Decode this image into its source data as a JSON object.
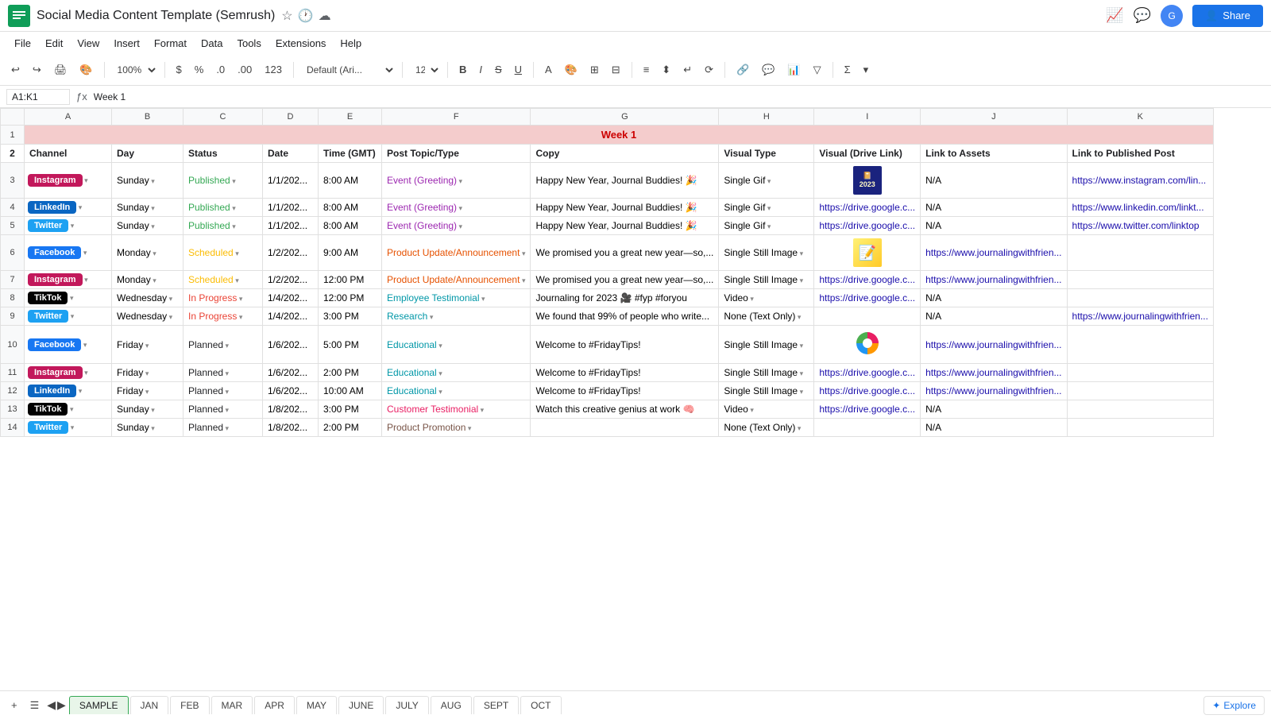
{
  "app": {
    "icon": "📊",
    "title": "Social Media Content Template (Semrush)",
    "menu": [
      "File",
      "Edit",
      "View",
      "Insert",
      "Format",
      "Data",
      "Tools",
      "Extensions",
      "Help"
    ],
    "share_label": "Share",
    "explore_label": "Explore"
  },
  "toolbar": {
    "zoom": "100%",
    "currency": "$",
    "percent": "%",
    "decimal_less": ".0",
    "decimal_more": ".00",
    "format_123": "123",
    "font_family": "Default (Ari...",
    "font_size": "12",
    "bold": "B",
    "italic": "I",
    "strikethrough": "S",
    "underline": "U"
  },
  "formula_bar": {
    "cell_ref": "A1:K1",
    "formula": "Week 1"
  },
  "sheet": {
    "week_label": "Week 1",
    "headers": [
      "Channel",
      "Day",
      "Status",
      "Date",
      "Time (GMT)",
      "Post Topic/Type",
      "Copy",
      "Visual Type",
      "Visual (Drive Link)",
      "Link to Assets",
      "Link to Published Post"
    ],
    "col_letters": [
      "A",
      "B",
      "C",
      "D",
      "E",
      "F",
      "G",
      "H",
      "I",
      "J",
      "K"
    ],
    "rows": [
      {
        "row_num": 3,
        "channel": "Instagram",
        "channel_type": "instagram",
        "day": "Sunday",
        "status": "Published",
        "status_type": "published",
        "date": "1/1/202...",
        "time": "8:00 AM",
        "topic": "Event (Greeting)",
        "topic_type": "event",
        "copy": "Happy New Year, Journal Buddies! 🎉",
        "visual_type": "Single Gif",
        "visual_link": "",
        "link_assets": "N/A",
        "link_published": "https://www.instagram.com/lin...",
        "has_thumb": "2023"
      },
      {
        "row_num": 4,
        "channel": "LinkedIn",
        "channel_type": "linkedin",
        "day": "Sunday",
        "status": "Published",
        "status_type": "published",
        "date": "1/1/202...",
        "time": "8:00 AM",
        "topic": "Event (Greeting)",
        "topic_type": "event",
        "copy": "Happy New Year, Journal Buddies! 🎉",
        "visual_type": "Single Gif",
        "visual_link": "https://drive.google.c...",
        "link_assets": "N/A",
        "link_published": "https://www.linkedin.com/linkt...",
        "has_thumb": ""
      },
      {
        "row_num": 5,
        "channel": "Twitter",
        "channel_type": "twitter",
        "day": "Sunday",
        "status": "Published",
        "status_type": "published",
        "date": "1/1/202...",
        "time": "8:00 AM",
        "topic": "Event (Greeting)",
        "topic_type": "event",
        "copy": "Happy New Year, Journal Buddies! 🎉",
        "visual_type": "Single Gif",
        "visual_link": "https://drive.google.c...",
        "link_assets": "N/A",
        "link_published": "https://www.twitter.com/linktop",
        "has_thumb": ""
      },
      {
        "row_num": 6,
        "channel": "Facebook",
        "channel_type": "facebook",
        "day": "Monday",
        "status": "Scheduled",
        "status_type": "scheduled",
        "date": "1/2/202...",
        "time": "9:00 AM",
        "topic": "Product Update/Announcement",
        "topic_type": "product",
        "copy": "We promised you a great new year—so,...",
        "visual_type": "Single Still Image",
        "visual_link": "",
        "link_assets": "https://www.journalingwithfrien...",
        "link_published": "",
        "has_thumb": "sticky"
      },
      {
        "row_num": 7,
        "channel": "Instagram",
        "channel_type": "instagram",
        "day": "Monday",
        "status": "Scheduled",
        "status_type": "scheduled",
        "date": "1/2/202...",
        "time": "12:00 PM",
        "topic": "Product Update/Announcement",
        "topic_type": "product",
        "copy": "We promised you a great new year—so,...",
        "visual_type": "Single Still Image",
        "visual_link": "https://drive.google.c...",
        "link_assets": "https://www.journalingwithfrien...",
        "link_published": "",
        "has_thumb": ""
      },
      {
        "row_num": 8,
        "channel": "TikTok",
        "channel_type": "tiktok",
        "day": "Wednesday",
        "status": "In Progress",
        "status_type": "inprogress",
        "date": "1/4/202...",
        "time": "12:00 PM",
        "topic": "Employee Testimonial",
        "topic_type": "employee",
        "copy": "Journaling for 2023 🎥 #fyp #foryou",
        "visual_type": "Video",
        "visual_link": "https://drive.google.c...",
        "link_assets": "N/A",
        "link_published": "",
        "has_thumb": ""
      },
      {
        "row_num": 9,
        "channel": "Twitter",
        "channel_type": "twitter",
        "day": "Wednesday",
        "status": "In Progress",
        "status_type": "inprogress",
        "date": "1/4/202...",
        "time": "3:00 PM",
        "topic": "Research",
        "topic_type": "research",
        "copy": "We found that 99% of people who write...",
        "visual_type": "None (Text Only)",
        "visual_link": "",
        "link_assets": "N/A",
        "link_published": "https://www.journalingwithfrien...",
        "has_thumb": ""
      },
      {
        "row_num": 10,
        "channel": "Facebook",
        "channel_type": "facebook",
        "day": "Friday",
        "status": "Planned",
        "status_type": "planned",
        "date": "1/6/202...",
        "time": "5:00 PM",
        "topic": "Educational",
        "topic_type": "educational",
        "copy": "Welcome to #FridayTips!",
        "visual_type": "Single Still Image",
        "visual_link": "",
        "link_assets": "https://www.journalingwithfrien...",
        "link_published": "",
        "has_thumb": "pie"
      },
      {
        "row_num": 11,
        "channel": "Instagram",
        "channel_type": "instagram",
        "day": "Friday",
        "status": "Planned",
        "status_type": "planned",
        "date": "1/6/202...",
        "time": "2:00 PM",
        "topic": "Educational",
        "topic_type": "educational",
        "copy": "Welcome to #FridayTips!",
        "visual_type": "Single Still Image",
        "visual_link": "https://drive.google.c...",
        "link_assets": "https://www.journalingwithfrien...",
        "link_published": "",
        "has_thumb": ""
      },
      {
        "row_num": 12,
        "channel": "LinkedIn",
        "channel_type": "linkedin",
        "day": "Friday",
        "status": "Planned",
        "status_type": "planned",
        "date": "1/6/202...",
        "time": "10:00 AM",
        "topic": "Educational",
        "topic_type": "educational",
        "copy": "Welcome to #FridayTips!",
        "visual_type": "Single Still Image",
        "visual_link": "https://drive.google.c...",
        "link_assets": "https://www.journalingwithfrien...",
        "link_published": "",
        "has_thumb": ""
      },
      {
        "row_num": 13,
        "channel": "TikTok",
        "channel_type": "tiktok",
        "day": "Sunday",
        "status": "Planned",
        "status_type": "planned",
        "date": "1/8/202...",
        "time": "3:00 PM",
        "topic": "Customer Testimonial",
        "topic_type": "customer",
        "copy": "Watch this creative genius at work 🧠",
        "visual_type": "Video",
        "visual_link": "https://drive.google.c...",
        "link_assets": "N/A",
        "link_published": "",
        "has_thumb": ""
      },
      {
        "row_num": 14,
        "channel": "Twitter",
        "channel_type": "twitter",
        "day": "Sunday",
        "status": "Planned",
        "status_type": "planned",
        "date": "1/8/202...",
        "time": "2:00 PM",
        "topic": "Product Promotion",
        "topic_type": "promo",
        "copy": "",
        "visual_type": "None (Text Only)",
        "visual_link": "",
        "link_assets": "N/A",
        "link_published": "",
        "has_thumb": ""
      }
    ]
  },
  "tabs": [
    "SAMPLE",
    "JAN",
    "FEB",
    "MAR",
    "APR",
    "MAY",
    "JUNE",
    "JULY",
    "AUG",
    "SEPT",
    "OCT"
  ],
  "active_tab": "SAMPLE"
}
